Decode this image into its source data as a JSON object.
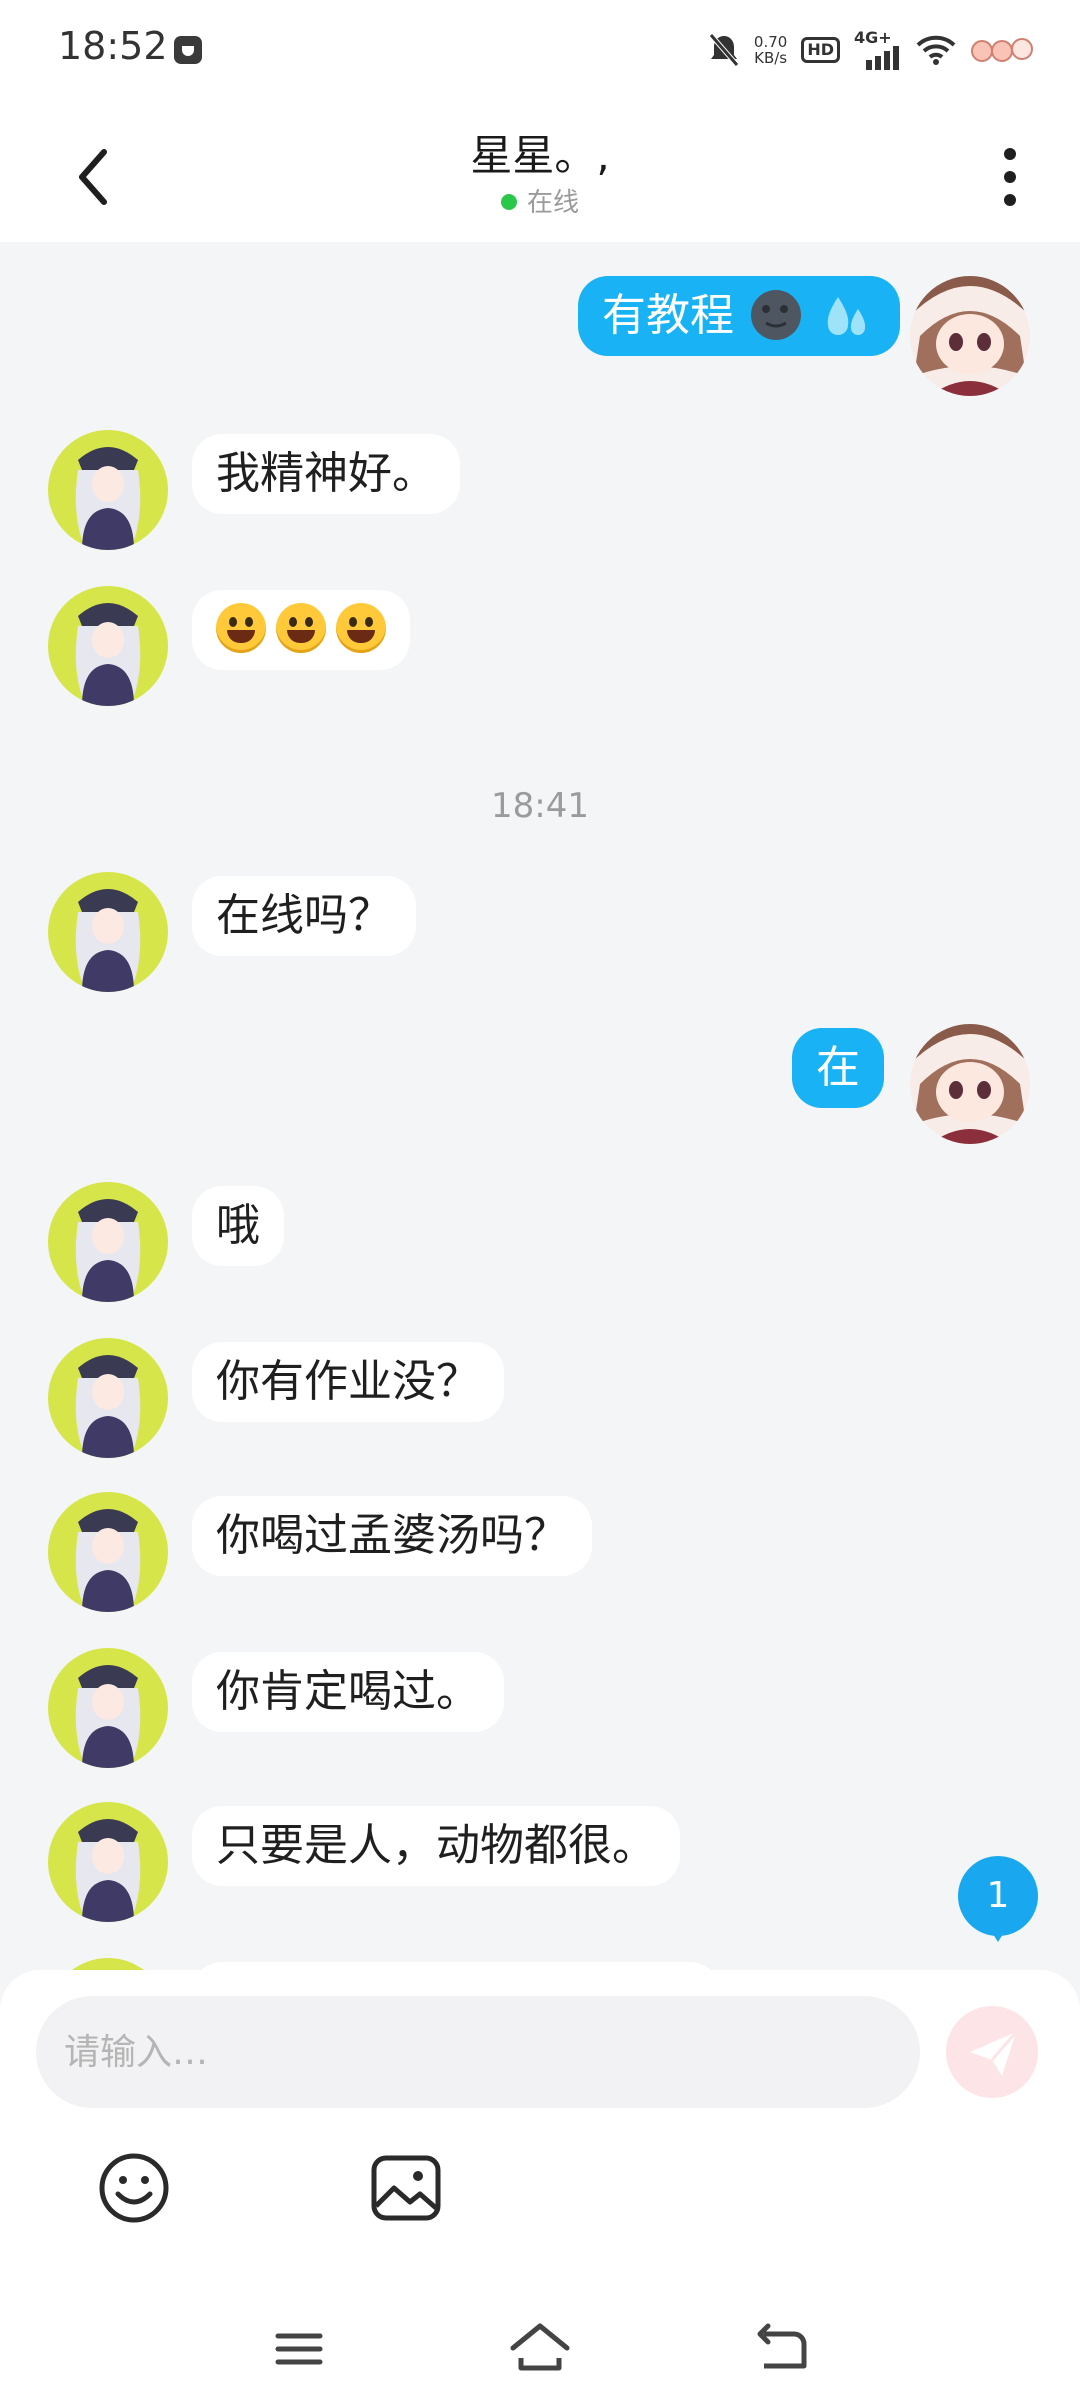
{
  "status_bar": {
    "time": "18:52",
    "net_speed_value": "0.70",
    "net_speed_unit": "KB/s",
    "hd_label": "HD",
    "network_label": "4G+",
    "icons": [
      "app-notification-icon",
      "mute-bell-icon",
      "signal-icon",
      "wifi-icon",
      "sticker-icons"
    ]
  },
  "header": {
    "title": "星星。,",
    "status": "在线",
    "status_color": "#2ac84a",
    "icons": [
      "back-arrow-icon",
      "more-vertical-icon"
    ]
  },
  "messages": [
    {
      "side": "out",
      "text": "有教程",
      "emoji": [
        "🌚",
        "💦"
      ]
    },
    {
      "side": "in",
      "text": "我精神好。"
    },
    {
      "side": "in",
      "text": "😀😀😀"
    },
    {
      "type": "time",
      "text": "18:41"
    },
    {
      "side": "in",
      "text": "在线吗？"
    },
    {
      "side": "out",
      "text": "在"
    },
    {
      "side": "in",
      "text": "哦"
    },
    {
      "side": "in",
      "text": "你有作业没？"
    },
    {
      "side": "in",
      "text": "你喝过孟婆汤吗？"
    },
    {
      "side": "in",
      "text": "你肯定喝过。"
    },
    {
      "side": "in",
      "text": "只要是人，动物都很。"
    }
  ],
  "unread_badge": "1",
  "input_bar": {
    "placeholder": "请输入…",
    "icons": [
      "send-icon",
      "emoji-icon",
      "image-icon"
    ]
  },
  "nav_bar": {
    "icons": [
      "menu-icon",
      "home-icon",
      "back-icon"
    ]
  },
  "colors": {
    "accent": "#19b2f5",
    "incoming_bubble": "#ffffff",
    "background": "#f4f5f7",
    "send_button": "#fde4e6",
    "avatar_in_bg": "#d6e64a"
  }
}
